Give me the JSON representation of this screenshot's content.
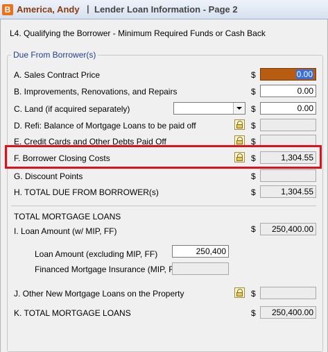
{
  "window": {
    "icon_letter": "B",
    "borrower_name": "America, Andy",
    "separator": "|",
    "page_title": "Lender Loan Information - Page 2"
  },
  "section_heading": "L4. Qualifying the Borrower - Minimum Required Funds or Cash Back",
  "due_from_borrower": {
    "legend": "Due From Borrower(s)",
    "rows": [
      {
        "label": "A. Sales Contract Price",
        "currency": "$",
        "value": "0.00"
      },
      {
        "label": "B. Improvements, Renovations, and Repairs",
        "currency": "$",
        "value": "0.00"
      },
      {
        "label": "C. Land (if acquired separately)",
        "currency": "$",
        "value": "0.00",
        "dropdown_value": ""
      },
      {
        "label": "D. Refi: Balance of Mortgage Loans to be paid off",
        "currency": "$",
        "value": ""
      },
      {
        "label": "E. Credit Cards and Other Debts Paid Off",
        "currency": "$",
        "value": ""
      },
      {
        "label": "F. Borrower Closing Costs",
        "currency": "$",
        "value": "1,304.55"
      },
      {
        "label": "G. Discount Points",
        "currency": "$",
        "value": ""
      },
      {
        "label": "H. TOTAL DUE FROM BORROWER(s)",
        "currency": "$",
        "value": "1,304.55"
      }
    ]
  },
  "mortgage_loans": {
    "heading": "TOTAL MORTGAGE LOANS",
    "loan_amount": {
      "label": "I. Loan Amount (w/ MIP, FF)",
      "currency": "$",
      "value": "250,400.00"
    },
    "loan_amount_excl": {
      "label": "Loan Amount (excluding MIP, FF)",
      "value": "250,400"
    },
    "financed_mi": {
      "label": "Financed Mortgage Insurance (MIP, FF)",
      "value": ""
    },
    "other_loans": {
      "label": "J. Other New Mortgage Loans on the Property",
      "currency": "$",
      "value": ""
    },
    "total": {
      "label": "K. TOTAL MORTGAGE LOANS",
      "currency": "$",
      "value": "250,400.00"
    }
  },
  "colors": {
    "title_name": "#8a3a10",
    "active_field": "#b85c12",
    "highlight_box": "#e0101a",
    "legend_text": "#1f3f8f"
  }
}
